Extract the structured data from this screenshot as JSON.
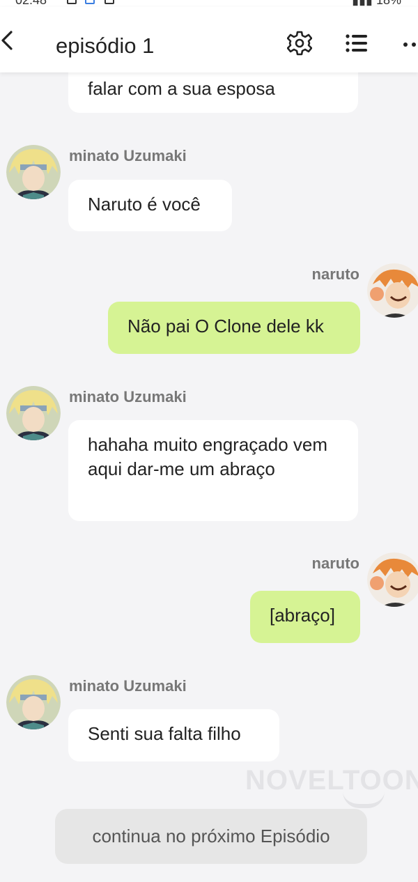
{
  "header": {
    "title": "episódio 1"
  },
  "messages": [
    {
      "side": "left",
      "sender": "",
      "text": "falar com a sua esposa"
    },
    {
      "side": "left",
      "sender": "minato Uzumaki",
      "text": "Naruto é você"
    },
    {
      "side": "right",
      "sender": "naruto",
      "text": "Não pai O Clone dele kk"
    },
    {
      "side": "left",
      "sender": "minato Uzumaki",
      "text": "hahaha muito engraçado vem aqui dar-me um abraço"
    },
    {
      "side": "right",
      "sender": "naruto",
      "text": "[abraço]"
    },
    {
      "side": "left",
      "sender": "minato Uzumaki",
      "text": "Senti sua falta filho"
    }
  ],
  "footer": {
    "continue_label": "continua no próximo Episódio"
  },
  "watermark": "NOVELTOON",
  "colors": {
    "background": "#f4f4f6",
    "bubble_other": "#ffffff",
    "bubble_me": "#d6f394",
    "sender_text": "#777777"
  }
}
